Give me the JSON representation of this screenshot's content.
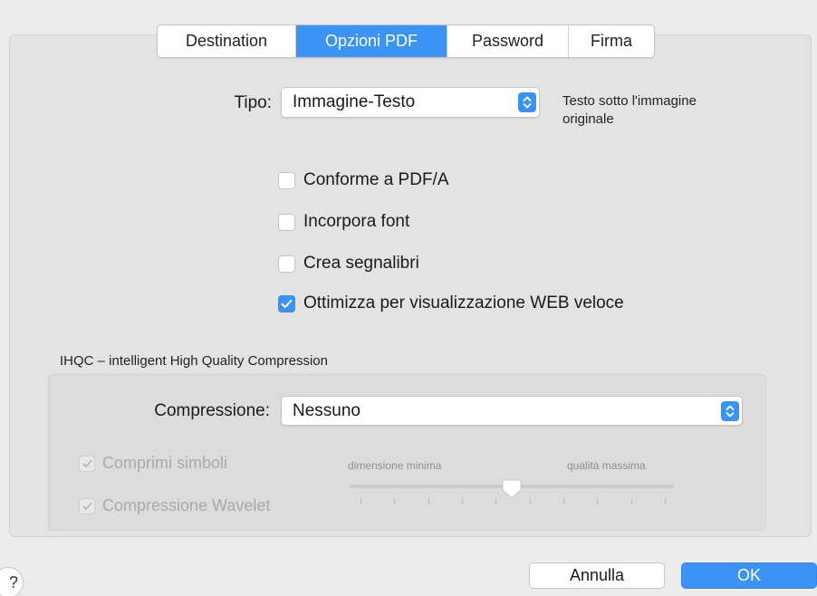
{
  "tabs": [
    {
      "label": "Destination",
      "active": false
    },
    {
      "label": "Opzioni PDF",
      "active": true
    },
    {
      "label": "Password",
      "active": false
    },
    {
      "label": "Firma",
      "active": false
    }
  ],
  "tipo": {
    "label": "Tipo:",
    "value": "Immagine-Testo",
    "description_line1": "Testo sotto l'immagine",
    "description_line2": "originale"
  },
  "options": [
    {
      "label": "Conforme a PDF/A",
      "checked": false
    },
    {
      "label": "Incorpora font",
      "checked": false
    },
    {
      "label": "Crea segnalibri",
      "checked": false
    },
    {
      "label": "Ottimizza per visualizzazione WEB veloce",
      "checked": true
    }
  ],
  "ihqc": {
    "title": "IHQC – intelligent High Quality Compression",
    "compression_label": "Compressione:",
    "compression_value": "Nessuno",
    "symbols_label": "Comprimi simboli",
    "symbols_checked": true,
    "wavelet_label": "Compressione Wavelet",
    "wavelet_checked": true,
    "slider_min_label": "dimensione minima",
    "slider_max_label": "qualità massima",
    "slider_position": 0.5,
    "enabled": false
  },
  "footer": {
    "help": "?",
    "cancel_label": "Annulla",
    "ok_label": "OK"
  },
  "colors": {
    "accent": "#3b93f5",
    "background": "#ececec",
    "disabled_text": "#a9a9a9"
  }
}
